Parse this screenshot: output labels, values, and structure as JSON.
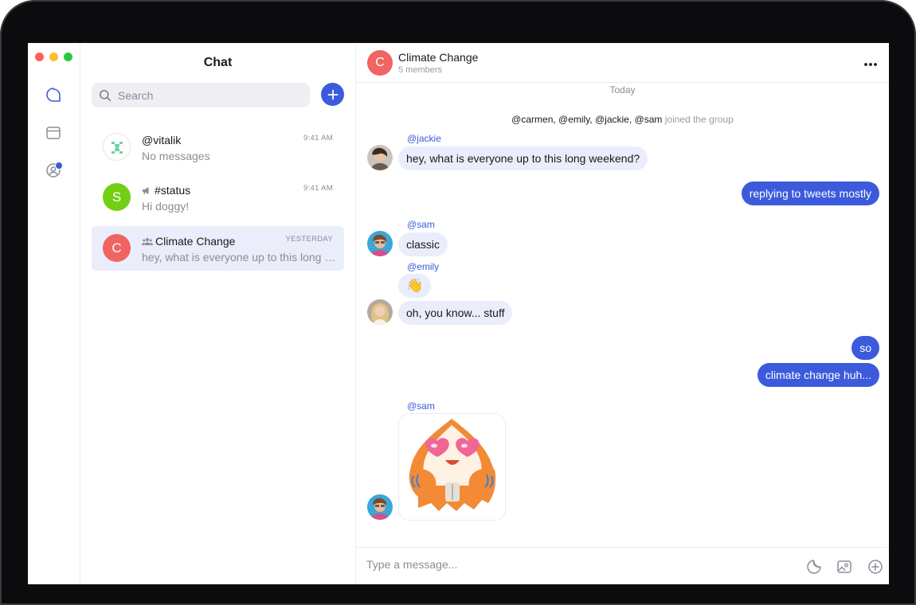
{
  "colors": {
    "accent": "#3c5bdc",
    "bubble_in": "#eaedfa",
    "red": "#f06462",
    "green": "#72cf14",
    "muted": "#8a8d97"
  },
  "window": {
    "controls": [
      "close",
      "minimize",
      "maximize"
    ]
  },
  "rail": {
    "items": [
      {
        "icon": "chat-bubble-icon"
      },
      {
        "icon": "inbox-icon"
      },
      {
        "icon": "account-icon",
        "badge": true
      }
    ]
  },
  "sidebar": {
    "title": "Chat",
    "search": {
      "placeholder": "Search",
      "value": ""
    },
    "new_icon": "plus-icon",
    "conversations": [
      {
        "name": "@vitalik",
        "preview": "No messages",
        "time": "9:41 AM",
        "avatar_icon": "identicon-icon"
      },
      {
        "name": "#status",
        "preview": "Hi doggy!",
        "time": "9:41 AM",
        "avatar_letter": "S",
        "avatar_color": "#72cf14",
        "type_icon": "megaphone-icon"
      },
      {
        "name": "Climate Change",
        "preview": "hey, what is everyone up to this long weekend?",
        "time": "YESTERDAY",
        "avatar_letter": "C",
        "avatar_color": "#f06462",
        "type_icon": "group-icon",
        "active": true
      }
    ]
  },
  "chat": {
    "header": {
      "avatar_letter": "C",
      "title": "Climate Change",
      "subtitle": "5 members",
      "more_label": "•••"
    },
    "date_divider": "Today",
    "system_message": {
      "users": "@carmen, @emily, @jackie, @sam",
      "text": "joined the group"
    },
    "messages": [
      {
        "sender": "@jackie",
        "text": "hey, what is everyone up to this long weekend?",
        "direction": "in"
      },
      {
        "text": "replying to tweets mostly",
        "direction": "out"
      },
      {
        "sender": "@sam",
        "text": "classic",
        "direction": "in"
      },
      {
        "sender": "@emily",
        "text": "👋",
        "direction": "in"
      },
      {
        "text": "oh, you know... stuff",
        "direction": "in"
      },
      {
        "text": "so",
        "direction": "out"
      },
      {
        "text": "climate change huh...",
        "direction": "out"
      },
      {
        "sender": "@sam",
        "sticker": "heart-eyes-sticker",
        "direction": "in"
      }
    ]
  },
  "composer": {
    "placeholder": "Type a message...",
    "value": "",
    "icons": [
      "sticker-icon",
      "image-icon",
      "add-circle-icon"
    ]
  }
}
